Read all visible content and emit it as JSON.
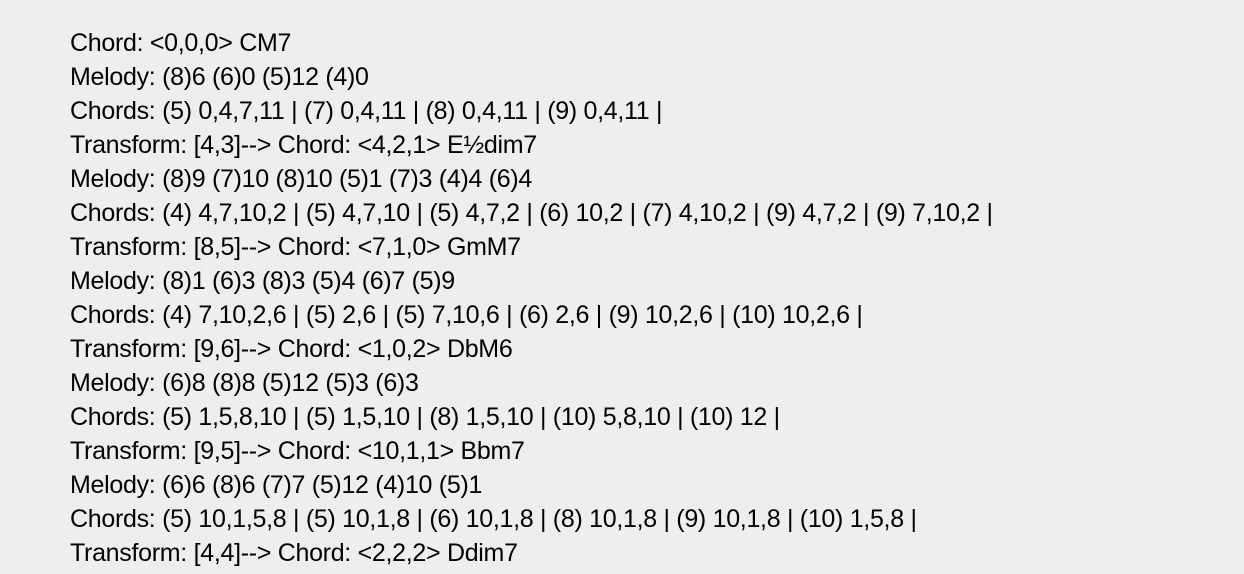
{
  "colors": {
    "background": "#eeeeee",
    "text": "#000000"
  },
  "lines": [
    "Chord: <0,0,0> CM7",
    "Melody: (8)6 (6)0 (5)12 (4)0",
    "Chords: (5) 0,4,7,11 | (7) 0,4,11 | (8) 0,4,11 | (9) 0,4,11 |",
    "Transform: [4,3]--> Chord: <4,2,1> E½dim7",
    "Melody: (8)9 (7)10 (8)10 (5)1 (7)3 (4)4 (6)4",
    "Chords: (4) 4,7,10,2 | (5) 4,7,10 | (5) 4,7,2 | (6) 10,2 | (7) 4,10,2 | (9) 4,7,2 | (9) 7,10,2 |",
    "Transform: [8,5]--> Chord: <7,1,0> GmM7",
    "Melody: (8)1 (6)3 (8)3 (5)4 (6)7 (5)9",
    "Chords: (4) 7,10,2,6 | (5) 2,6 | (5) 7,10,6 | (6) 2,6 | (9) 10,2,6 | (10) 10,2,6 |",
    "Transform: [9,6]--> Chord: <1,0,2> DbM6",
    "Melody: (6)8 (8)8 (5)12 (5)3 (6)3",
    "Chords: (5) 1,5,8,10 | (5) 1,5,10 | (8) 1,5,10 | (10) 5,8,10 | (10) 12 |",
    "Transform: [9,5]--> Chord: <10,1,1> Bbm7",
    "Melody: (6)6 (8)6 (7)7 (5)12 (4)10 (5)1",
    "Chords: (5) 10,1,5,8 | (5) 10,1,8 | (6) 10,1,8 | (8) 10,1,8 | (9) 10,1,8 | (10) 1,5,8 |",
    "Transform: [4,4]--> Chord: <2,2,2> Ddim7"
  ]
}
